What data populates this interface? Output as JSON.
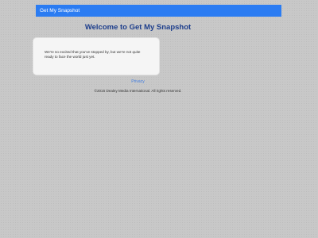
{
  "navbar": {
    "brand": "Get My Snapshot"
  },
  "main": {
    "title": "Welcome to Get My Snapshot",
    "card_text": "We're so excited that you've stopped by, but we're not quite ready to face the world just yet."
  },
  "footer": {
    "privacy_label": "Privacy",
    "copyright": "©2016 Dealey Media International. All rights reserved."
  },
  "colors": {
    "navbar_bg": "#2b7cf2",
    "title": "#1d3e8c",
    "link": "#3f7be0",
    "page_bg": "#c8c8c8"
  }
}
